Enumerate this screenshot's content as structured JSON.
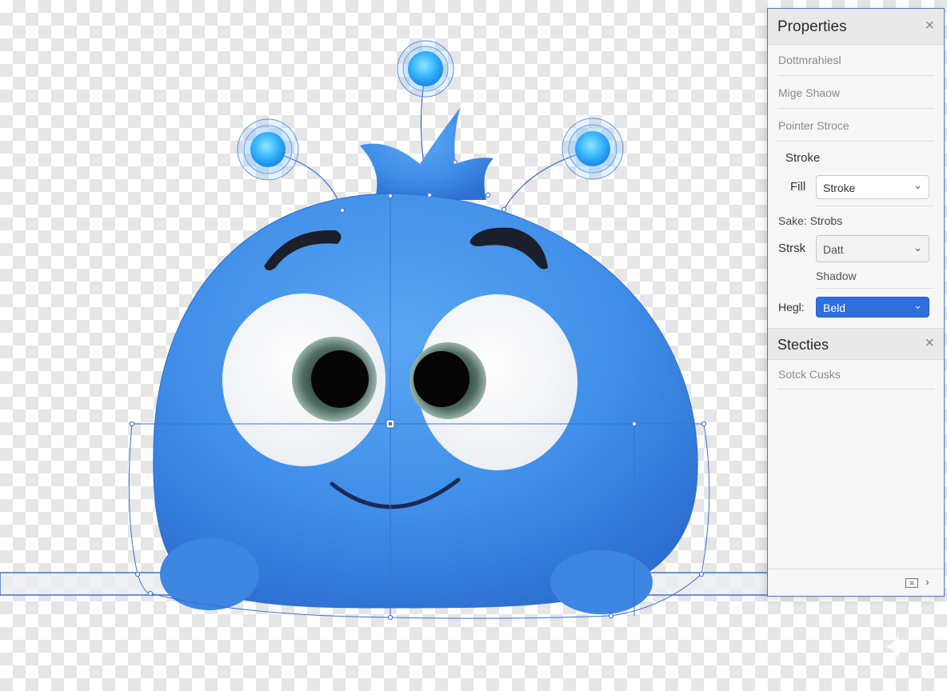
{
  "panel": {
    "title": "Properties",
    "close_glyph": "×",
    "rows": [
      "Dottmrahiesl",
      "Mige Shaow",
      "Pointer Stroce"
    ],
    "stroke_heading": "Stroke",
    "fill_label": "Fill",
    "fill_value": "Stroke",
    "sake_label": "Sake: Strobs",
    "strsk_label": "Strsk",
    "strsk_value": "Datt",
    "shadow_label": "Shadow",
    "hegl_label": "Hegl:",
    "hegl_value": "Beld",
    "chevron_glyph": "⌄"
  },
  "section2": {
    "title": "Stecties",
    "close_glyph": "×",
    "rows": [
      "Sotck Cusks"
    ]
  },
  "footer": {
    "chevron_glyph": "›"
  },
  "icons": {
    "close": "close-icon",
    "chevron": "chevron-down-icon",
    "panel_toggle": "panel-toggle-icon",
    "sparkle": "sparkle-icon"
  },
  "colors": {
    "character_blue": "#3f8ee8",
    "selection_blue": "#3d6fd1",
    "accent_select": "#2f6fdd",
    "handle_glow": "#4fc3ff"
  }
}
